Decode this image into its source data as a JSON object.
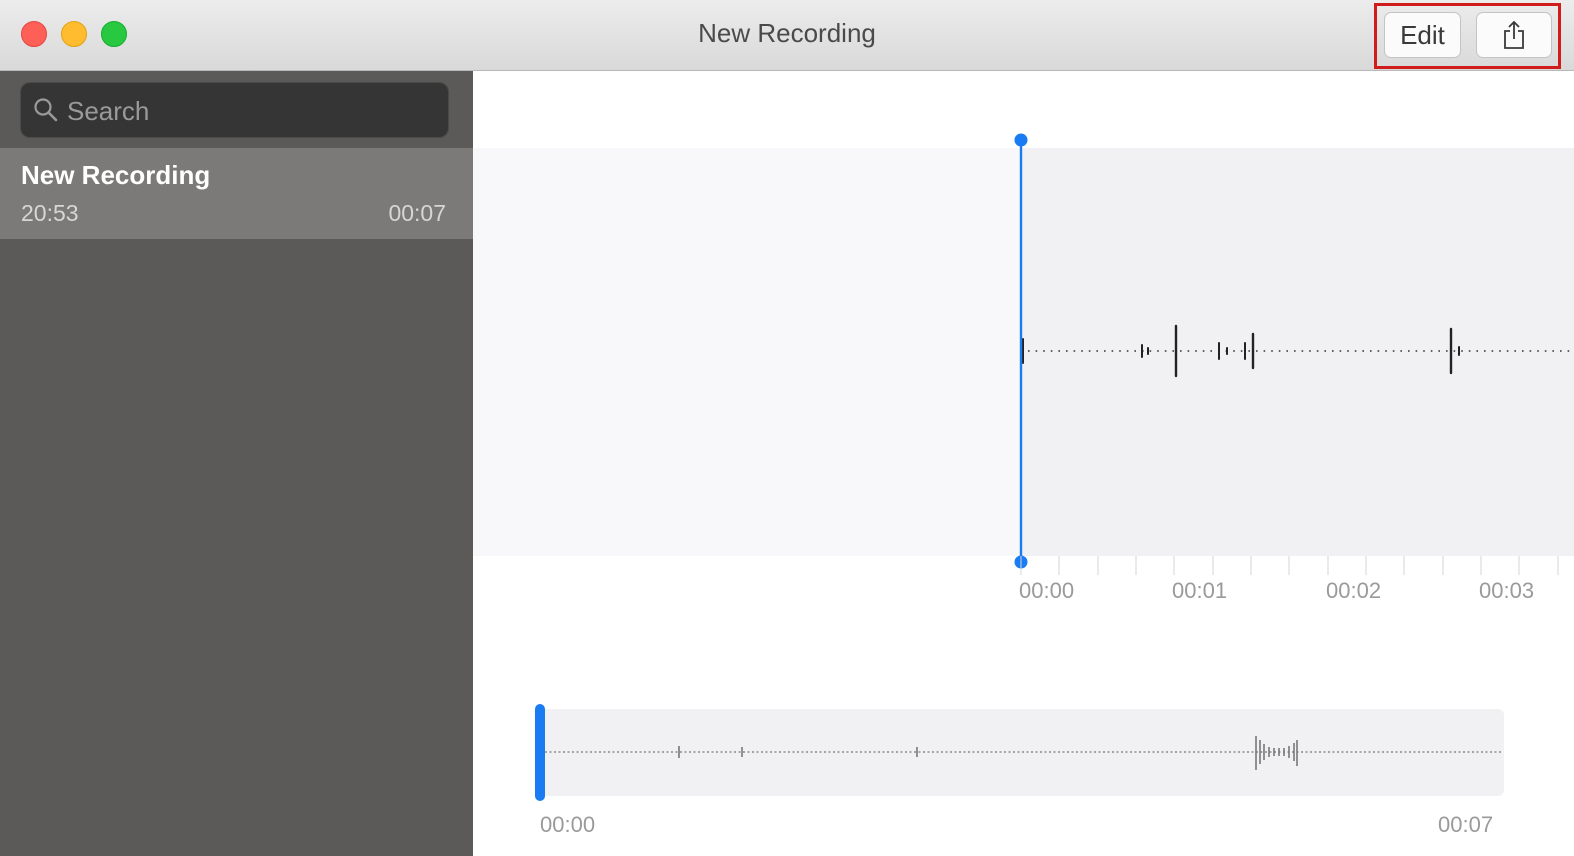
{
  "window": {
    "title": "New Recording"
  },
  "toolbar": {
    "edit_label": "Edit"
  },
  "sidebar": {
    "search_placeholder": "Search",
    "recordings": [
      {
        "name": "New Recording",
        "time": "20:53",
        "duration": "00:07"
      }
    ]
  },
  "timeline": {
    "ticks": [
      "00:00",
      "00:01",
      "00:02",
      "00:03"
    ]
  },
  "overview": {
    "start": "00:00",
    "end": "00:07"
  },
  "colors": {
    "accent": "#1a7cf3",
    "highlight": "#d11c1c"
  }
}
